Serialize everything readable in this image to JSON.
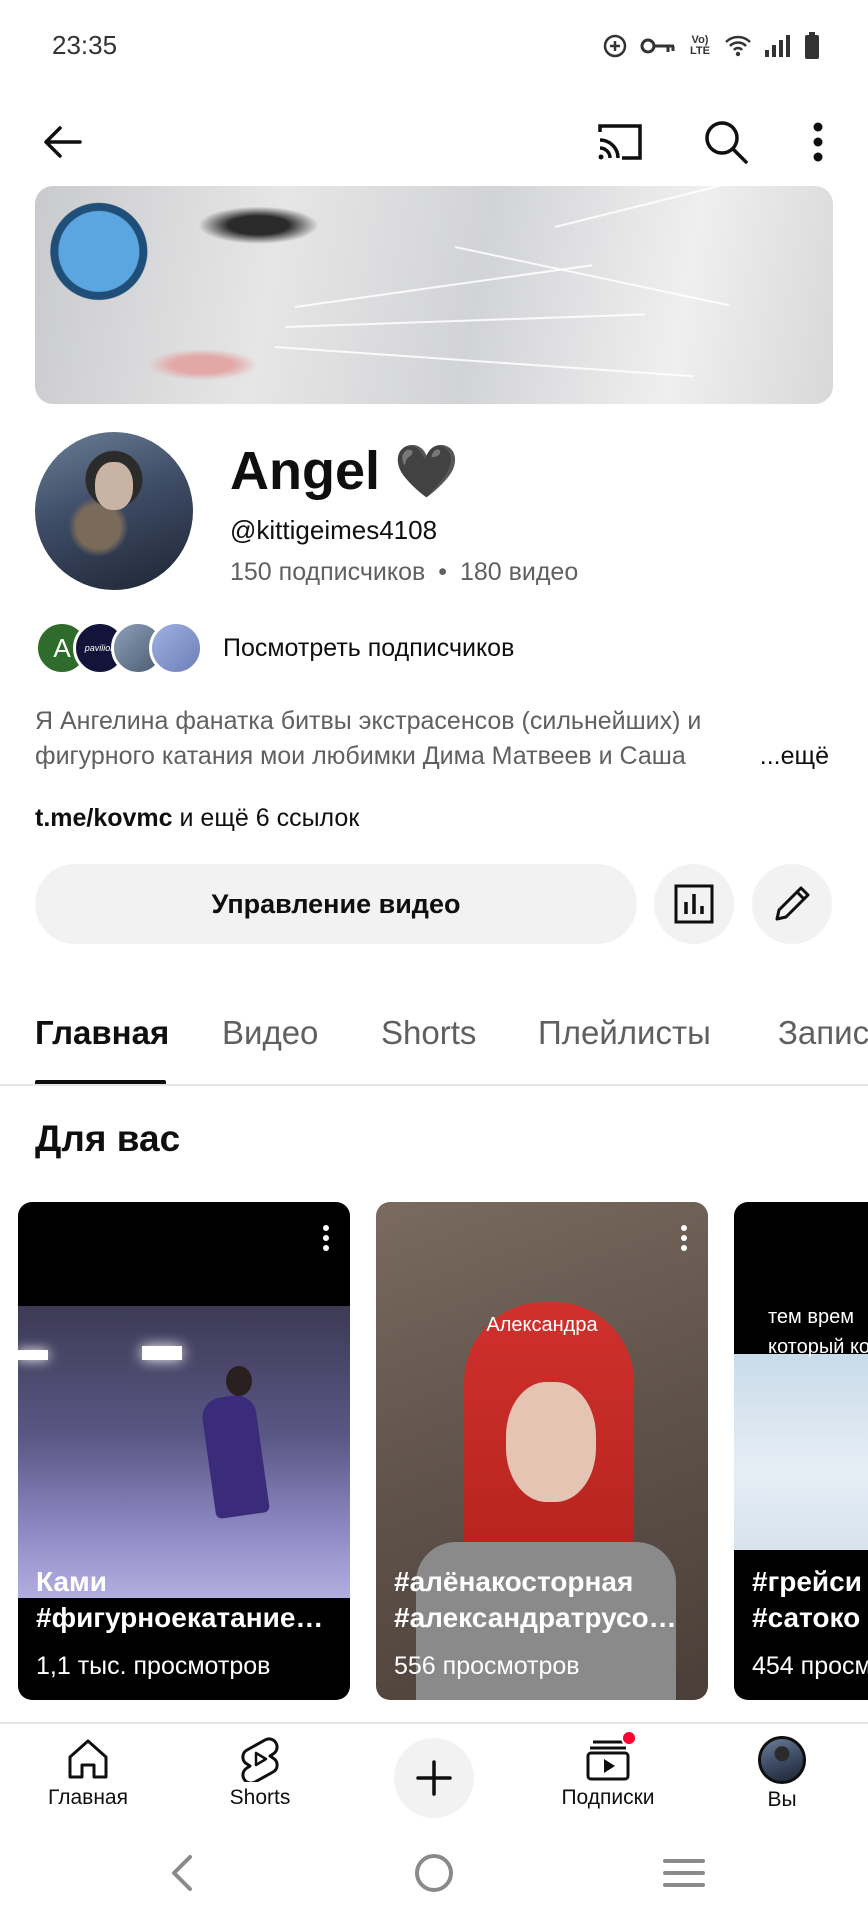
{
  "status_bar": {
    "time": "23:35",
    "icons": [
      "data-saver-icon",
      "vpn-key-icon",
      "volte-lte-icon",
      "wifi-icon",
      "signal-icon",
      "battery-icon"
    ],
    "volte_text": "Vo) LTE"
  },
  "top_bar": {
    "icons": [
      "back-arrow-icon",
      "cast-icon",
      "search-icon",
      "more-vert-icon"
    ]
  },
  "channel": {
    "name": "Angel",
    "name_emoji": "🖤",
    "handle": "@kittigeimes4108",
    "subscribers": "150 подписчиков",
    "separator": "•",
    "videos": "180 видео",
    "view_subscribers_label": "Посмотреть подписчиков",
    "subscriber_avatar_letter": "A",
    "subscriber_avatar_text": "pavilion",
    "description": "Я Ангелина фанатка битвы экстрасенсов (сильнейших) и фигурного катания мои любимки Дима Матвеев и Саша",
    "description_more": "...ещё",
    "link_main": "t.me/kovmc",
    "link_rest": " и ещё 6 ссылок"
  },
  "actions": {
    "manage_videos_label": "Управление видео",
    "analytics_icon": "analytics-icon",
    "edit_icon": "edit-pencil-icon"
  },
  "tabs": [
    {
      "label": "Главная",
      "active": true
    },
    {
      "label": "Видео",
      "active": false
    },
    {
      "label": "Shorts",
      "active": false
    },
    {
      "label": "Плейлисты",
      "active": false
    },
    {
      "label": "Записи",
      "active": false
    }
  ],
  "section": {
    "title": "Для вас"
  },
  "shorts": [
    {
      "title": "Ками #фигурноекатание…",
      "title_line1": "Ками",
      "title_line2": "#фигурноекатание…",
      "views": "1,1 тыс. просмотров"
    },
    {
      "title": "#алёнакосторная #александратрусо…",
      "title_line1": "#алёнакосторная",
      "title_line2": "#александратрусо…",
      "views": "556 просмотров",
      "overlay": "Александра"
    },
    {
      "title": "#грейси #сатоко",
      "title_line1": "#грейси",
      "title_line2": "#сатоко",
      "views": "454 просм",
      "overlay": "тем врем который ко"
    }
  ],
  "bottom_nav": [
    {
      "label": "Главная",
      "icon": "home-icon"
    },
    {
      "label": "Shorts",
      "icon": "shorts-icon"
    },
    {
      "label": "",
      "icon": "create-plus-icon"
    },
    {
      "label": "Подписки",
      "icon": "subscriptions-icon"
    },
    {
      "label": "Вы",
      "icon": "profile-avatar-icon"
    }
  ],
  "colors": {
    "text_primary": "#0f0f0f",
    "text_secondary": "#606060",
    "button_bg": "#f2f2f2",
    "notification_dot": "#ff0033"
  }
}
